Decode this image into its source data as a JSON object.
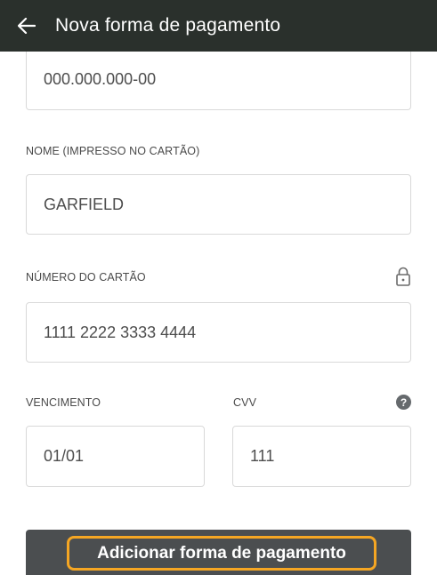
{
  "header": {
    "title": "Nova forma de pagamento",
    "back_icon": "arrow-left-icon"
  },
  "form": {
    "cpf": {
      "value": "000.000.000-00"
    },
    "name": {
      "label": "NOME (IMPRESSO NO CARTÃO)",
      "value": "GARFIELD"
    },
    "card_number": {
      "label": "NÚMERO DO CARTÃO",
      "value": "1111 2222 3333 4444",
      "icon": "lock-icon"
    },
    "expiry": {
      "label": "VENCIMENTO",
      "value": "01/01"
    },
    "cvv": {
      "label": "CVV",
      "value": "111",
      "help_icon": "help-icon",
      "help_text": "?"
    }
  },
  "actions": {
    "submit_label": "Adicionar forma de pagamento"
  },
  "colors": {
    "appbar": "#2a302c",
    "highlight": "#f5a623",
    "button": "#4b4e50"
  }
}
